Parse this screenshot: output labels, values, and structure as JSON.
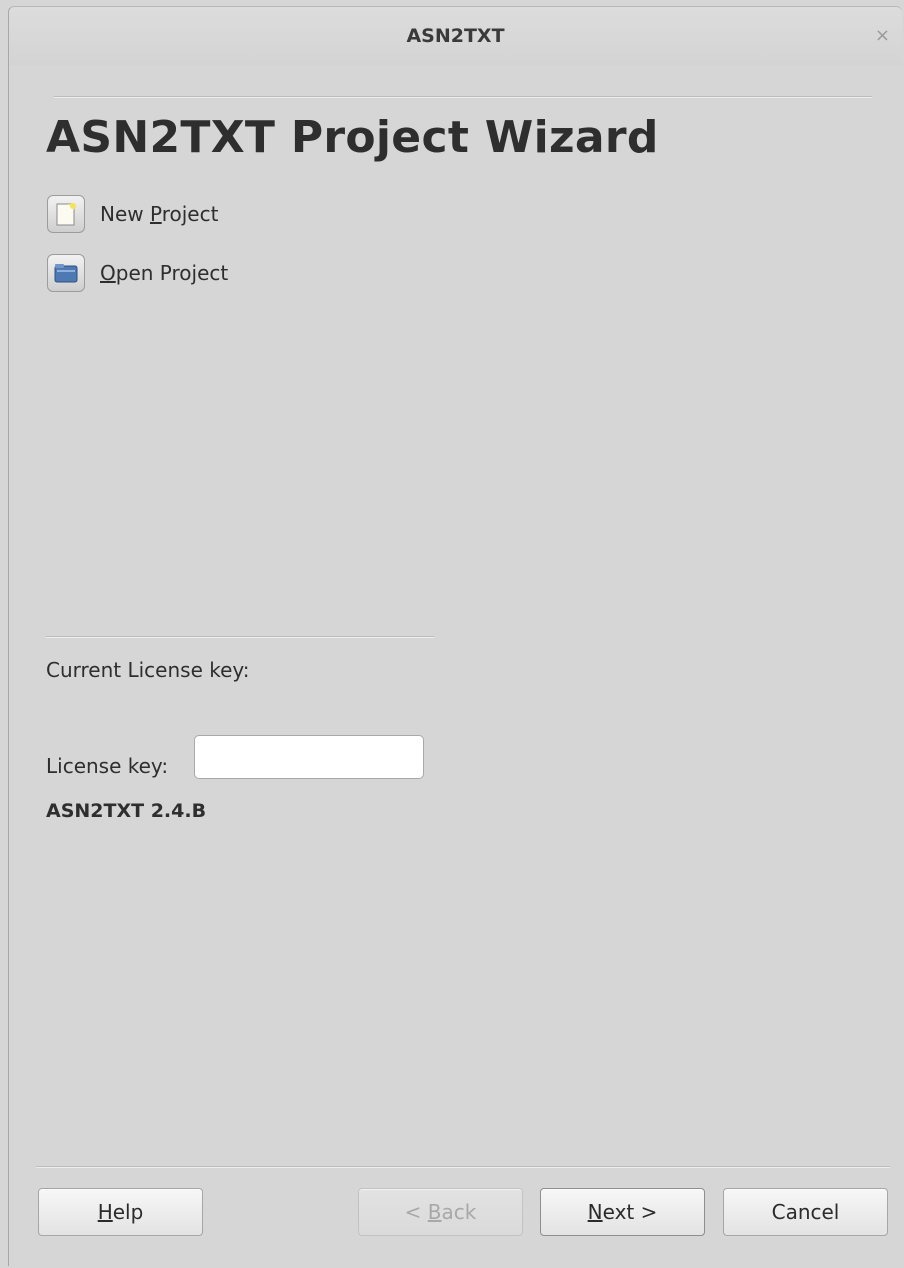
{
  "window": {
    "title": "ASN2TXT",
    "close_glyph": "×"
  },
  "wizard": {
    "heading": "ASN2TXT Project Wizard",
    "actions": [
      {
        "pre": "New ",
        "mnemonic": "P",
        "post": "roject",
        "icon": "new-document-icon"
      },
      {
        "pre": "",
        "mnemonic": "O",
        "post": "pen Project",
        "icon": "folder-icon"
      }
    ]
  },
  "license": {
    "current_label": "Current License key:",
    "key_label": "License key:",
    "key_value": "",
    "version": "ASN2TXT 2.4.B"
  },
  "buttons": {
    "help": {
      "mnemonic": "H",
      "post": "elp"
    },
    "back": {
      "pre": "< ",
      "mnemonic": "B",
      "post": "ack",
      "enabled": false
    },
    "next": {
      "mnemonic": "N",
      "post": "ext >"
    },
    "cancel": {
      "label": "Cancel"
    }
  },
  "colors": {
    "background": "#d6d6d6",
    "button_face": "#eeeeee",
    "disabled_text": "#a8a8a8",
    "folder_blue": "#4f79b3",
    "note_yellow": "#f3e35a"
  }
}
